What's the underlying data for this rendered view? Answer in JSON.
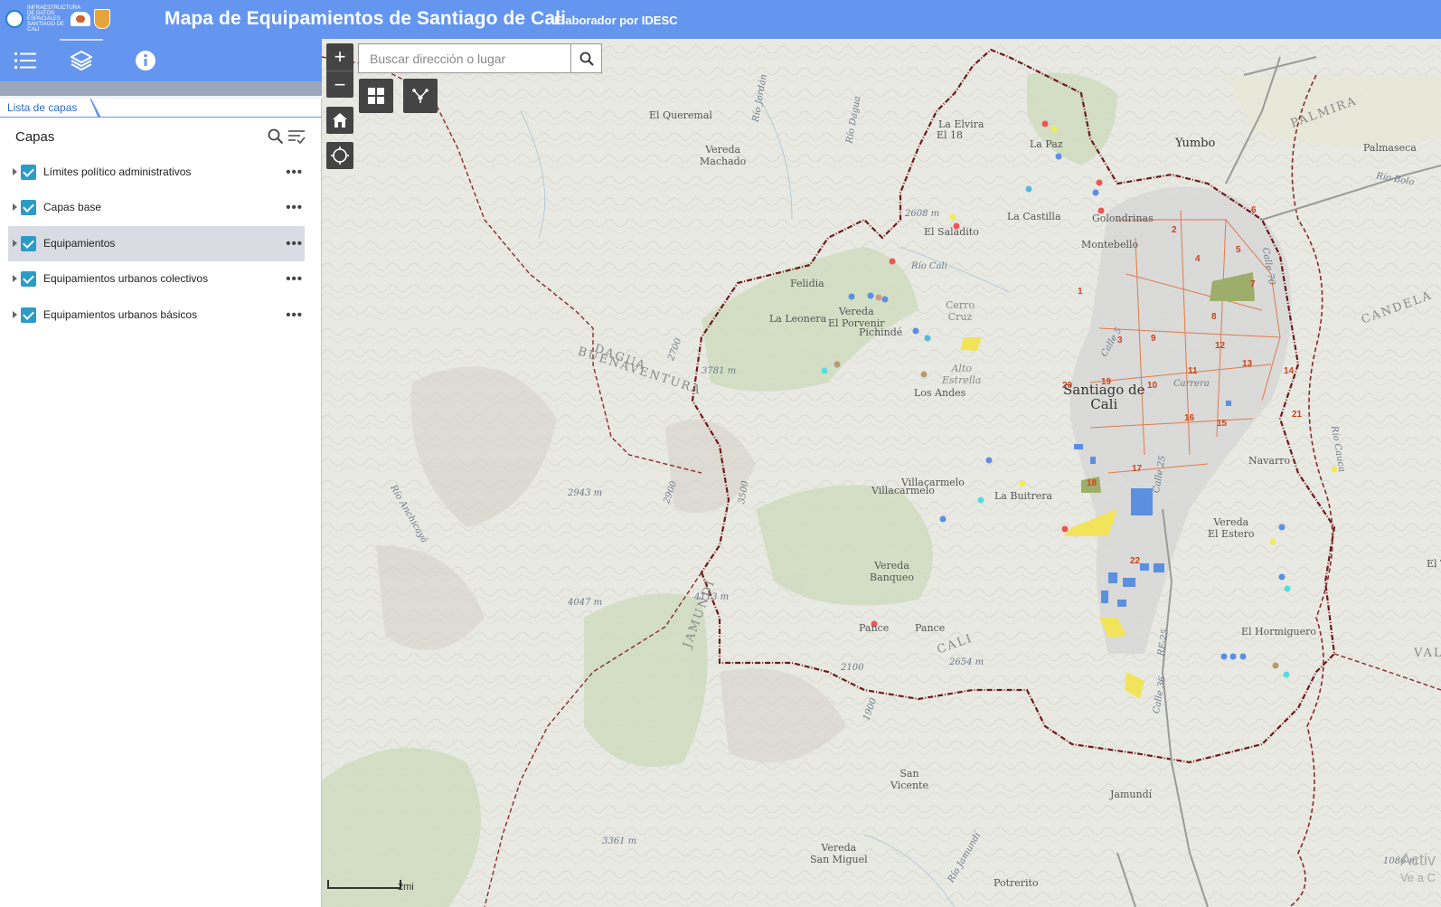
{
  "header": {
    "logo_text": "INFRAESTRUCTURA DE DATOS ESPACIALES SANTIAGO DE CALI",
    "title": "Mapa de Equipamientos de Santiago de Cali",
    "subtitle": "Elaborador por IDESC",
    "accent_color": "#6496f0"
  },
  "toolbar": {
    "icons": [
      "list-icon",
      "layers-icon",
      "info-icon"
    ],
    "active": "layers-icon"
  },
  "panel": {
    "tab_label": "Lista de capas",
    "title": "Capas",
    "layers": [
      {
        "label": "Límites político administrativos",
        "checked": true,
        "selected": false
      },
      {
        "label": "Capas base",
        "checked": true,
        "selected": false
      },
      {
        "label": "Equipamientos",
        "checked": true,
        "selected": true
      },
      {
        "label": "Equipamientos urbanos colectivos",
        "checked": true,
        "selected": false
      },
      {
        "label": "Equipamientos urbanos básicos",
        "checked": true,
        "selected": false
      }
    ],
    "menu_glyph": "•••"
  },
  "map": {
    "search_placeholder": "Buscar dirección o lugar",
    "zoom_in": "+",
    "zoom_out": "−",
    "scale_text": "2mi",
    "watermark_line1": "Activ",
    "watermark_line2": "Ve a C",
    "places": {
      "el_queremal": "El Queremal",
      "vereda_machado": "Vereda\nMachado",
      "la_elvira": "La Elvira",
      "el_18": "El 18",
      "la_paz": "La Paz",
      "yumbo": "Yumbo",
      "palmaseca": "Palmaseca",
      "palmira": "PALMIRA",
      "la_castilla": "La Castilla",
      "golondrinas": "Golondrinas",
      "el_saladito": "El Saladito",
      "montebello": "Montebello",
      "felidia": "Felidia",
      "la_leonera": "La Leonera",
      "vereda_el_porvenir": "Vereda\nEl Porvenir",
      "pichinde": "Pichindé",
      "cerro_cruz": "Cerro\nCruz",
      "alto_estrella": "Alto\nEstrella",
      "los_andes": "Los Andes",
      "santiago_de_cali": "Santiago de\nCali",
      "dagua": "DAGUA",
      "buenaventura": "BUENAVENTURA",
      "villacarmelo": "Villacarmelo",
      "villacarmelo2": "Villacarmelo",
      "la_buitrera": "La Buitrera",
      "navarro": "Navarro",
      "candelaria": "CANDELA",
      "vereda_el_estero": "Vereda\nEl Estero",
      "vereda_banqueo": "Vereda\nBanqueo",
      "pance1": "Pance",
      "pance2": "Pance",
      "el_hormiguero": "El Hormiguero",
      "jamundi_area": "JAMUNDÍ",
      "cali_area": "CALI",
      "san_vicente": "San\nVicente",
      "jamundi": "Jamundí",
      "vereda_san_miguel": "Vereda\nSan Miguel",
      "potrerito": "Potrerito",
      "vall": "VALL",
      "el_t": "El T"
    },
    "elevations": {
      "e1": "2608 m",
      "e2": "3781 m",
      "e3": "2943 m",
      "e4": "4047 m",
      "e5": "4113 m",
      "e6": "3361 m",
      "e7": "2654 m",
      "e8": "1086 m",
      "c1": "2700",
      "c2": "2900",
      "c3": "3500",
      "c4": "2100",
      "c5": "1900"
    },
    "rivers": {
      "r1": "Río Jordán",
      "r2": "Río Dagua",
      "r3": "Río Cali",
      "r4": "Río Anchicayá",
      "r5": "Río Cauca",
      "r6": "Río Bolo",
      "r7": "Río Jamundí"
    },
    "roads": {
      "calle70": "Calle 70",
      "calle5": "Calle 5",
      "calle25": "Calle 25",
      "calle36": "Calle 36",
      "rf25": "RF-25",
      "carrera": "Carrera"
    },
    "communes": [
      "1",
      "2",
      "3",
      "4",
      "5",
      "6",
      "7",
      "8",
      "9",
      "10",
      "11",
      "12",
      "13",
      "14",
      "15",
      "16",
      "17",
      "18",
      "19",
      "20",
      "21",
      "22"
    ]
  }
}
